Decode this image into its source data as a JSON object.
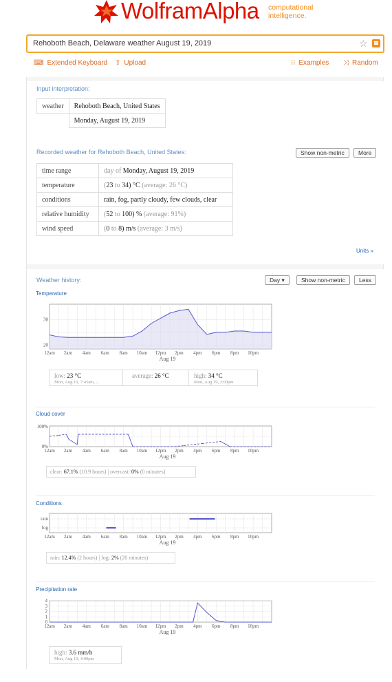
{
  "header": {
    "brand": "WolframAlpha",
    "tagline_1": "computational",
    "tagline_2": "intelligence.",
    "query": "Rehoboth Beach, Delaware weather August 19, 2019"
  },
  "toolbar": {
    "extended_keyboard": "Extended Keyboard",
    "upload": "Upload",
    "examples": "Examples",
    "random": "Random"
  },
  "input_interpretation": {
    "title": "Input interpretation:",
    "key": "weather",
    "location": "Rehoboth Beach, United States",
    "date": "Monday, August 19, 2019"
  },
  "recorded": {
    "title": "Recorded weather for Rehoboth Beach, United States:",
    "show_non_metric": "Show non-metric",
    "more": "More",
    "units_link": "Units »",
    "rows": [
      {
        "label": "time range",
        "pre": "day of ",
        "main": "Monday, August 19, 2019",
        "post": ""
      },
      {
        "label": "temperature",
        "pre": "(",
        "main": "23",
        "mid": " to ",
        "main2": "34",
        "unit": ") °C ",
        "post": "(average: 26 °C)"
      },
      {
        "label": "conditions",
        "pre": "",
        "main": "rain, fog, partly cloudy, few clouds, clear",
        "post": ""
      },
      {
        "label": "relative humidity",
        "pre": "(",
        "main": "52",
        "mid": " to ",
        "main2": "100",
        "unit": ") % ",
        "post": "(average: 91%)"
      },
      {
        "label": "wind speed",
        "pre": "(",
        "main": "0",
        "mid": " to ",
        "main2": "8",
        "unit": ") m/s ",
        "post": "(average: 3 m/s)"
      }
    ]
  },
  "history": {
    "title": "Weather history:",
    "period": "Day ▾",
    "show_non_metric": "Show non-metric",
    "less": "Less",
    "x_ticks": [
      "12am",
      "2am",
      "4am",
      "6am",
      "8am",
      "10am",
      "12pm",
      "2pm",
      "4pm",
      "6pm",
      "8pm",
      "10pm"
    ],
    "x_label": "Aug 19"
  },
  "temperature": {
    "title": "Temperature",
    "low_label": "low:",
    "low_value": "23 °C",
    "low_time": "Mon, Aug 19, 7:45am, ...",
    "avg_label": "average:",
    "avg_value": "26 °C",
    "high_label": "high:",
    "high_value": "34 °C",
    "high_time": "Mon, Aug 19, 2:00pm"
  },
  "cloud_cover": {
    "title": "Cloud cover",
    "clear_label": "clear:",
    "clear_value": "67.1%",
    "clear_detail": "(10.9 hours)",
    "overcast_label": "overcast:",
    "overcast_value": "0%",
    "overcast_detail": "(0 minutes)"
  },
  "conditions": {
    "title": "Conditions",
    "rain_label": "rain:",
    "rain_value": "12.4%",
    "rain_detail": "(2 hours)",
    "fog_label": "fog:",
    "fog_value": "2%",
    "fog_detail": "(20 minutes)"
  },
  "precipitation": {
    "title": "Precipitation rate",
    "high_label": "high:",
    "high_value": "3.6 mm/h",
    "high_time": "Mon, Aug 19, 4:00pm"
  },
  "colors": {
    "brand_red": "#dd1100",
    "accent_orange": "#f28e20",
    "link_blue": "#2866b2",
    "series_blue": "#5555cc"
  },
  "chart_data": [
    {
      "type": "line",
      "title": "Temperature",
      "x": [
        0,
        1,
        2,
        3,
        4,
        5,
        6,
        7,
        8,
        9,
        10,
        11,
        12,
        13,
        14,
        15,
        16,
        17,
        18,
        19,
        20,
        21,
        22,
        23,
        24
      ],
      "x_tick_labels": [
        "12am",
        "2am",
        "4am",
        "6am",
        "8am",
        "10am",
        "12pm",
        "2pm",
        "4pm",
        "6pm",
        "8pm",
        "10pm"
      ],
      "xlabel": "Aug 19",
      "y_ticks": [
        20,
        30
      ],
      "ylim": [
        18.5,
        36
      ],
      "series": [
        {
          "values": [
            24.0,
            23.2,
            23.0,
            23.0,
            23.0,
            23.0,
            23.0,
            23.0,
            23.0,
            23.5,
            25.5,
            28.5,
            30.5,
            32.5,
            33.5,
            34.0,
            28.0,
            24.2,
            25.0,
            25.0,
            25.5,
            25.5,
            25.0,
            25.0,
            25.0
          ]
        }
      ]
    },
    {
      "type": "line",
      "title": "Cloud cover",
      "xlabel": "Aug 19",
      "y_ticks": [
        "0%",
        "100%"
      ],
      "ylim": [
        0,
        100
      ],
      "series": [
        {
          "values": [
            [
              0,
              50
            ],
            [
              1,
              55
            ],
            [
              1.8,
              60
            ],
            [
              2.1,
              35
            ],
            [
              3,
              10
            ],
            [
              3.1,
              60
            ],
            [
              8.5,
              60
            ],
            [
              9,
              0
            ],
            [
              13.5,
              0
            ],
            [
              14.5,
              5
            ],
            [
              16.5,
              15
            ],
            [
              18.5,
              25
            ],
            [
              19.5,
              0
            ],
            [
              24,
              0
            ]
          ]
        }
      ]
    },
    {
      "type": "scatter",
      "title": "Conditions",
      "xlabel": "Aug 19",
      "categories": [
        "rain",
        "fog"
      ],
      "series": [
        {
          "name": "rain",
          "x": [
            15.5,
            16,
            16.5,
            17,
            17.5
          ]
        },
        {
          "name": "fog",
          "x": [
            6.5,
            6.8
          ]
        }
      ]
    },
    {
      "type": "line",
      "title": "Precipitation rate",
      "xlabel": "Aug 19",
      "y_ticks": [
        0,
        1,
        2,
        3,
        4
      ],
      "ylim": [
        0,
        4
      ],
      "series": [
        {
          "values": [
            [
              0,
              0
            ],
            [
              15.5,
              0
            ],
            [
              16,
              3.6
            ],
            [
              17,
              1.8
            ],
            [
              18,
              0.3
            ],
            [
              19,
              0
            ],
            [
              24,
              0
            ]
          ]
        }
      ]
    }
  ]
}
